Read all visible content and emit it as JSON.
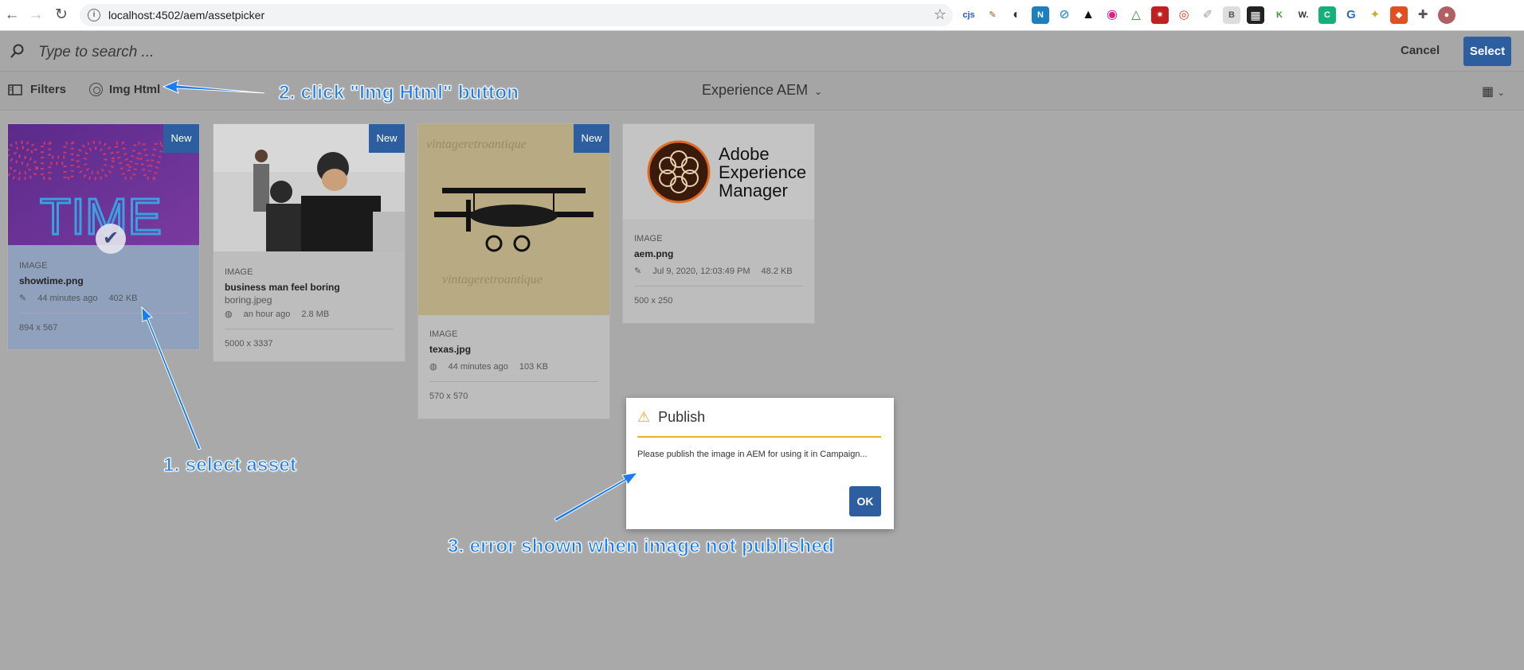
{
  "browser": {
    "url": "localhost:4502/aem/assetpicker",
    "extensions": [
      "cjs",
      "pen",
      "circle",
      "N",
      "shield",
      "hat",
      "eye",
      "tri",
      "star",
      "record",
      "pen2",
      "B",
      "grid",
      "K",
      "W",
      "C",
      "G",
      "idea",
      "fox",
      "puzzle",
      "avatar"
    ]
  },
  "search": {
    "placeholder": "Type to search ..."
  },
  "actions": {
    "cancel": "Cancel",
    "select": "Select"
  },
  "toolbar": {
    "filters": "Filters",
    "img_html": "Img Html",
    "context": "Experience AEM"
  },
  "cards": [
    {
      "badge": "New",
      "type": "IMAGE",
      "name": "showtime.png",
      "modified": "44 minutes ago",
      "size": "402 KB",
      "dimensions": "894 x 567",
      "selected": true
    },
    {
      "badge": "New",
      "type": "IMAGE",
      "name": "business man feel boring",
      "file": "boring.jpeg",
      "modified": "an hour ago",
      "size": "2.8 MB",
      "dimensions": "5000 x 3337"
    },
    {
      "badge": "New",
      "type": "IMAGE",
      "name": "texas.jpg",
      "modified": "44 minutes ago",
      "size": "103 KB",
      "dimensions": "570 x 570"
    },
    {
      "type": "IMAGE",
      "name": "aem.png",
      "modified": "Jul 9, 2020, 12:03:49 PM",
      "size": "48.2 KB",
      "dimensions": "500 x 250",
      "logo_text": [
        "Adobe",
        "Experience",
        "Manager"
      ]
    }
  ],
  "dialog": {
    "title": "Publish",
    "message": "Please publish the image in AEM for using it in Campaign...",
    "ok": "OK"
  },
  "annotations": {
    "step1": "1. select asset",
    "step2": "2. click \"Img Html\" button",
    "step3": "3. error shown when image not published"
  },
  "colors": {
    "accent": "#2d5ea0",
    "annotation": "#1a7cf0",
    "warning": "#e8a61f"
  }
}
